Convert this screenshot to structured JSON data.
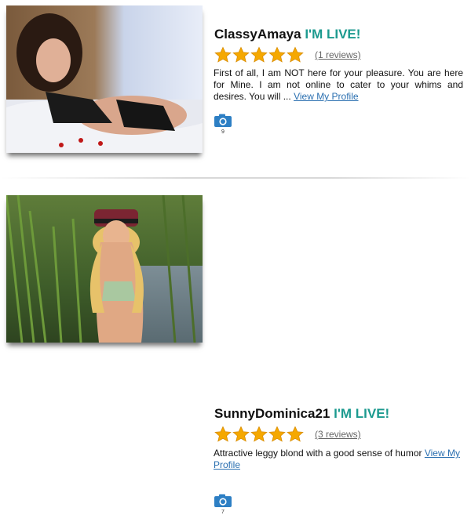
{
  "profiles": [
    {
      "name": "ClassyAmaya",
      "live_label": "I'M LIVE!",
      "rating_stars": 5,
      "reviews_label": "(1 reviews)",
      "description": "First of all, I am NOT here for your pleasure. You are here for Mine. I am not online to cater to your whims and desires. You will ...",
      "profile_link": "View My Profile",
      "photo_count": "9"
    },
    {
      "name": "SunnyDominica21",
      "live_label": "I'M LIVE!",
      "rating_stars": 5,
      "reviews_label": "(3 reviews)",
      "description": "Attractive leggy blond with a good sense of humor",
      "profile_link": "View My Profile",
      "photo_count": "7"
    }
  ],
  "colors": {
    "live": "#1c9a8f",
    "link": "#2a6fb0",
    "star": "#f5a800",
    "camera": "#2d7fc4"
  },
  "icons": {
    "rating": "star-icon",
    "photos": "camera-icon"
  }
}
